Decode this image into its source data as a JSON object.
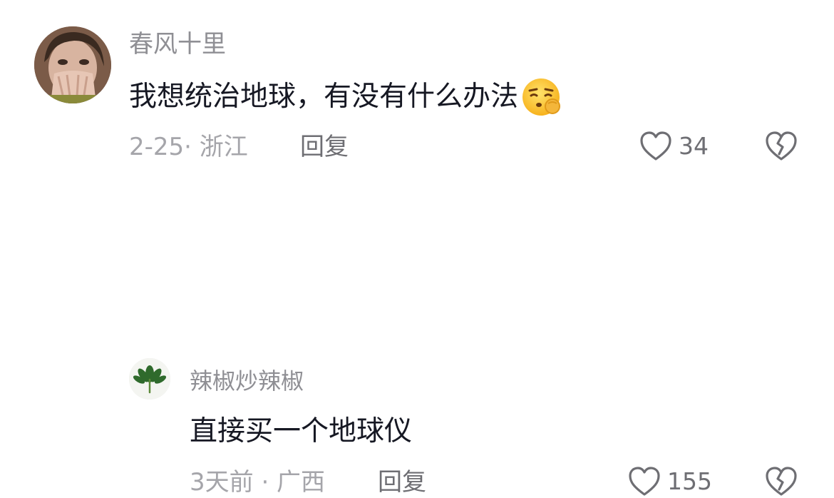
{
  "comments": [
    {
      "username": "春风十里",
      "text": "我想统治地球，有没有什么办法",
      "emoji": "thinking-shush-emoji",
      "meta": "2-25· 浙江",
      "reply_label": "回复",
      "like_count": "34"
    }
  ],
  "replies": [
    {
      "username": "辣椒炒辣椒",
      "text": "直接买一个地球仪",
      "meta": "3天前 · 广西",
      "reply_label": "回复",
      "like_count": "155"
    }
  ],
  "colors": {
    "username": "#8f8f94",
    "text": "#161823",
    "meta": "#a5a5aa",
    "icon": "#6e6e73"
  }
}
